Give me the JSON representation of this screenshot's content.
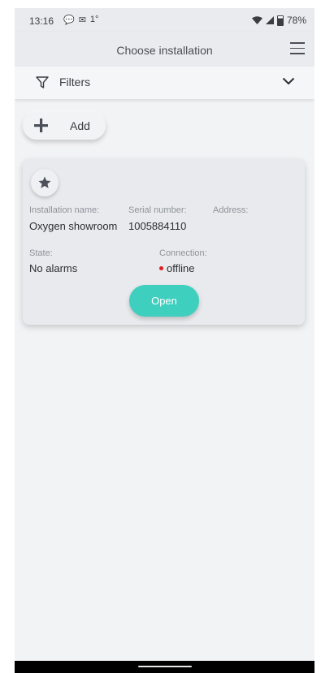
{
  "status_bar": {
    "time": "13:16",
    "notification_icons": [
      "chat-bubble-icon",
      "gmail-icon",
      "temperature-icon"
    ],
    "notification_text": "1°",
    "battery": "78%"
  },
  "header": {
    "title": "Choose installation"
  },
  "filters": {
    "label": "Filters"
  },
  "add_button": {
    "label": "Add"
  },
  "installation": {
    "name_label": "Installation name:",
    "name_value": "Oxygen showroom",
    "serial_label": "Serial number:",
    "serial_value": "1005884110",
    "address_label": "Address:",
    "address_value": "",
    "state_label": "State:",
    "state_value": "No alarms",
    "connection_label": "Connection:",
    "connection_value": "offline",
    "open_label": "Open"
  },
  "colors": {
    "accent": "#3fcfbf",
    "offline": "#e02020",
    "background": "#f2f3f5",
    "card": "#e8eaed"
  }
}
